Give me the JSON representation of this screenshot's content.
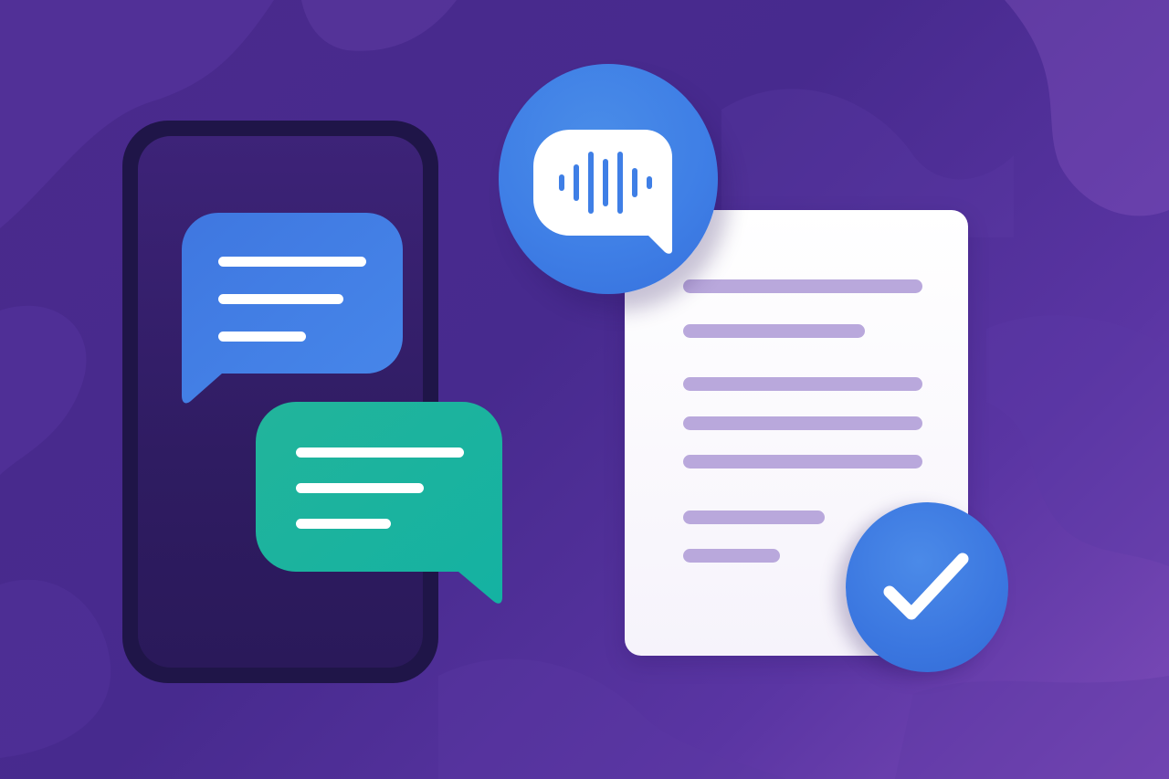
{
  "colors": {
    "background": "#4a2a8c",
    "phone_frame": "#1f1548",
    "phone_screen": "#33206a",
    "bubble_blue": "#3f7fe6",
    "bubble_green": "#1fb59f",
    "document": "#ffffff",
    "document_lines": "#b9a8dc",
    "accent_blue": "#3b77e0"
  },
  "icons": {
    "voice_message": "voice-message-icon",
    "checkmark": "checkmark-icon"
  }
}
